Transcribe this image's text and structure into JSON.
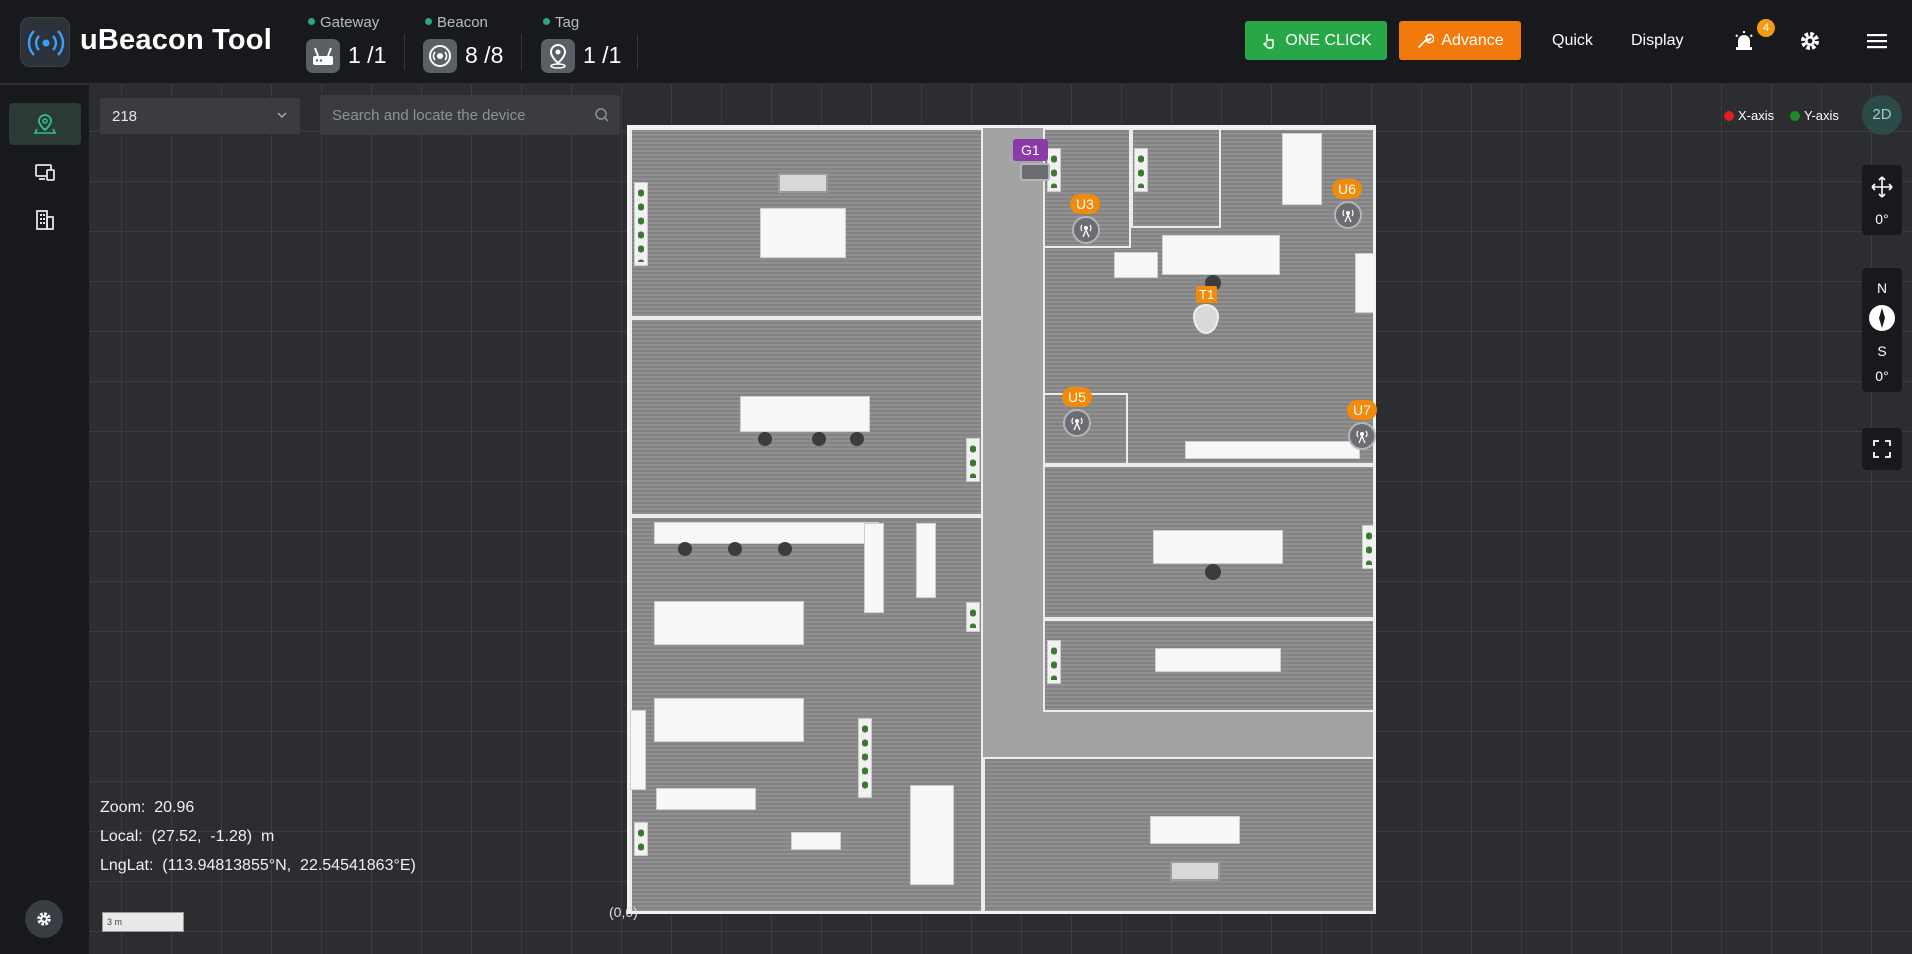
{
  "header": {
    "title": "uBeacon Tool",
    "stats": [
      {
        "label": "Gateway",
        "value": "1 /1",
        "icon": "router-icon"
      },
      {
        "label": "Beacon",
        "value": "8 /8",
        "icon": "beacon-icon"
      },
      {
        "label": "Tag",
        "value": "1 /1",
        "icon": "tag-pin-icon"
      }
    ],
    "one_click_label": "ONE CLICK",
    "advance_label": "Advance",
    "quick_label": "Quick",
    "display_label": "Display",
    "notification_count": "4"
  },
  "toolbar": {
    "floor_value": "218",
    "search_placeholder": "Search and locate the device"
  },
  "legend": {
    "x_axis": "X-axis",
    "y_axis": "Y-axis",
    "x_color": "#e21f1f",
    "y_color": "#1f8a2a"
  },
  "controls": {
    "view_mode": "2D",
    "rotation": "0°",
    "compass_n": "N",
    "compass_s": "S",
    "compass_deg": "0°"
  },
  "markers": {
    "gateway": "G1",
    "tag": "T1",
    "beacons": [
      "U3",
      "U6",
      "U5",
      "U7"
    ]
  },
  "info": {
    "zoom_label": "Zoom:",
    "zoom_value": "20.96",
    "local_label": "Local:",
    "local_value": "(27.52,  -1.28)  m",
    "lnglat_label": "LngLat:",
    "lnglat_value": "(113.94813855°N,  22.54541863°E)",
    "scale": "3 m",
    "origin": "(0,0)"
  },
  "colors": {
    "accent_green": "#27a747",
    "accent_orange": "#f27a0c",
    "gateway_purple": "#8b3aa8"
  }
}
